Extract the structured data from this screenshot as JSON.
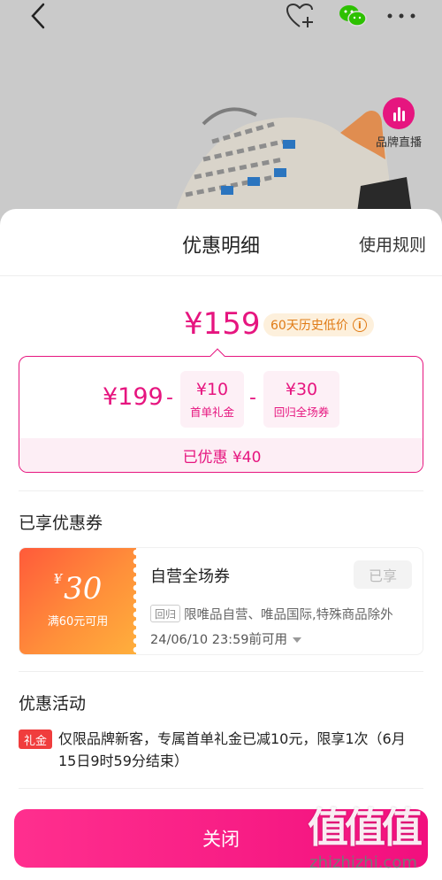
{
  "live": {
    "label": "品牌直播"
  },
  "sheet": {
    "title": "优惠明细",
    "rules_link": "使用规则"
  },
  "price": {
    "final": "¥159",
    "history_badge": "60天历史低价",
    "info_glyph": "i"
  },
  "calc": {
    "original": "¥199",
    "minus": "-",
    "discounts": [
      {
        "amount": "¥10",
        "label": "首单礼金"
      },
      {
        "amount": "¥30",
        "label": "回归全场券"
      }
    ],
    "saved": "已优惠 ¥40"
  },
  "coupons": {
    "section_title": "已享优惠券",
    "item": {
      "currency": "¥",
      "amount": "30",
      "condition": "满60元可用",
      "name": "自营全场券",
      "status": "已享",
      "tag": "回归",
      "scope": "限唯品自营、唯品国际,特殊商品除外",
      "expiry": "24/06/10 23:59前可用"
    }
  },
  "activities": {
    "section_title": "优惠活动",
    "item": {
      "tag": "礼金",
      "text": "仅限品牌新客，专属首单礼金已减10元，限享1次（6月15日9时59分结束）"
    }
  },
  "footer": {
    "close_label": "关闭"
  },
  "watermark": {
    "logo_text": "值值值",
    "site": "zhizhizhi.com"
  },
  "colors": {
    "accent": "#e6157f",
    "button": "#f20f7e",
    "coupon_gradient_start": "#ff5a3a",
    "coupon_gradient_end": "#ffb03c",
    "activity_tag": "#f03d3d"
  }
}
